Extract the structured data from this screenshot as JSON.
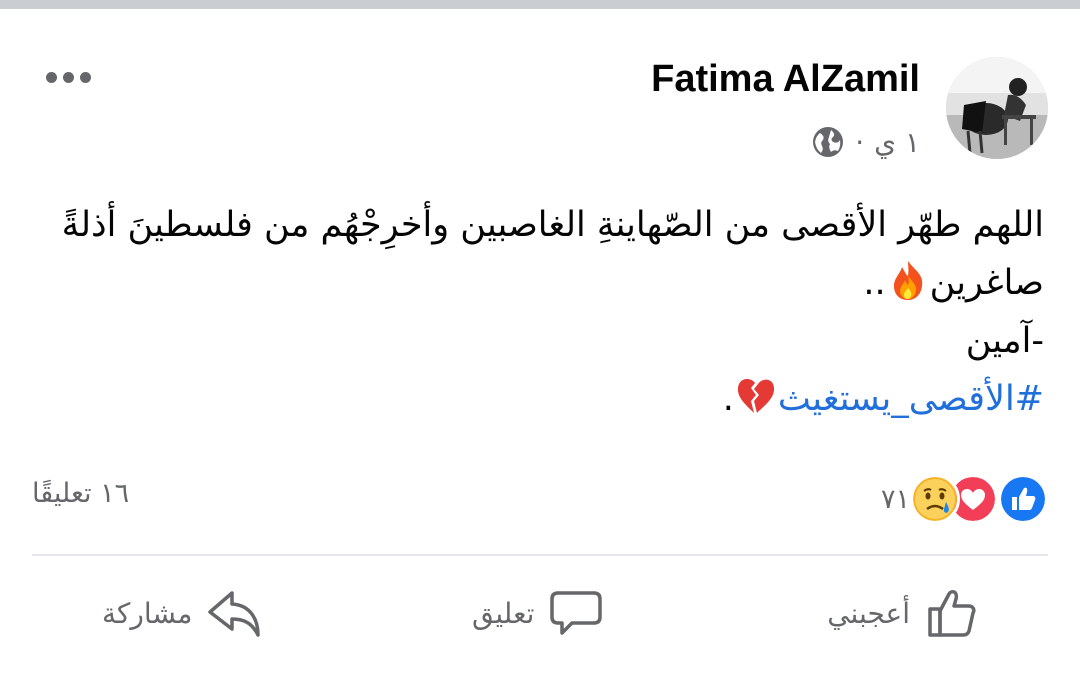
{
  "post": {
    "author": "Fatima AlZamil",
    "time": "١ ي",
    "separator": "·",
    "privacy_icon": "globe-icon",
    "menu_icon": "more-options-icon",
    "text_line1": "اللهم طهّر الأقصى من الصّهاينةِ الغاصبين وأخرِجْهُم من فلسطينَ أذلةً",
    "text_line2": "صاغرين",
    "text_line2_suffix": "..",
    "text_line2_emoji": "fire-emoji",
    "text_line3": "-آمين",
    "hashtag": "#الأقصى_يستغيث",
    "hashtag_emoji": "broken-heart-emoji",
    "hashtag_suffix": "."
  },
  "stats": {
    "reactions": [
      "like-reaction",
      "love-reaction",
      "sad-reaction"
    ],
    "reaction_count": "٧١",
    "comments": "١٦ تعليقًا"
  },
  "actions": {
    "like_label": "أعجبني",
    "comment_label": "تعليق",
    "share_label": "مشاركة"
  },
  "colors": {
    "like_blue": "#1877f2",
    "love_red": "#f33e58",
    "hashtag_blue": "#216fdb",
    "secondary_text": "#65676b"
  }
}
